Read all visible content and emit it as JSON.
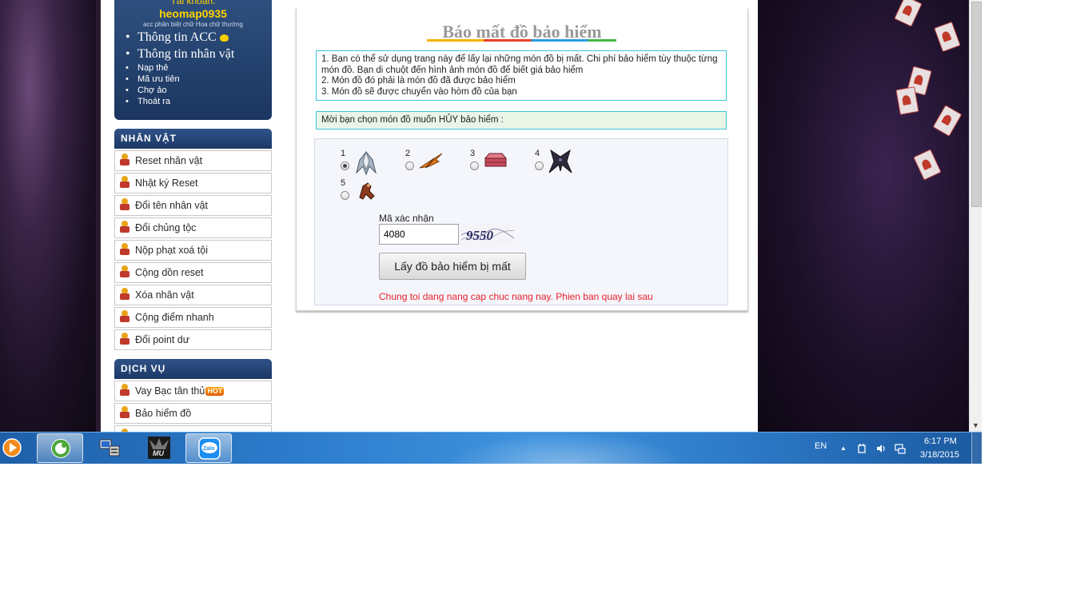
{
  "account": {
    "label": "Tài khoản:",
    "username": "heomap0935",
    "note": "acc phân biệt chữ Hoa chữ thường",
    "links_big": [
      "Thông tin ACC",
      "Thông tin nhân vật"
    ],
    "links_small": [
      "Nạp thẻ",
      "Mã ưu tiên",
      "Chợ ảo",
      "Thoát ra"
    ]
  },
  "character_section": {
    "title": "NHÂN VẬT",
    "items": [
      "Reset nhân vật",
      "Nhật ký Reset",
      "Đổi tên nhân vật",
      "Đổi chủng tộc",
      "Nộp phạt xoá tội",
      "Cộng dồn reset",
      "Xóa nhân vật",
      "Cộng điểm nhanh",
      "Đổi point dư"
    ]
  },
  "service_section": {
    "title": "DỊCH VỤ",
    "items": [
      "Vay Bạc tân thủ",
      "Bảo hiểm đồ"
    ],
    "hot_badge": "HOT"
  },
  "main": {
    "title": "Báo mất đồ bảo hiểm",
    "info_lines": [
      "1. Bạn có thể sử dụng trang này để lấy lại những món đồ bị mất. Chi phí bảo hiểm tùy thuộc từng món đồ. Bạn di chuột đến hình ảnh món đồ để biết giá bảo hiểm",
      "2. Món đồ đó phải là món đồ đã được bảo hiểm",
      "3. Món đồ sẽ được chuyển vào hòm đồ của bạn"
    ],
    "choose_prompt": "Mời bạn chọn món đồ muốn HỦY bảo hiểm :",
    "items": [
      {
        "number": "1",
        "selected": true,
        "icon": "wings-icon"
      },
      {
        "number": "2",
        "selected": false,
        "icon": "bow-icon"
      },
      {
        "number": "3",
        "selected": false,
        "icon": "chest-icon"
      },
      {
        "number": "4",
        "selected": false,
        "icon": "dark-wings-icon"
      },
      {
        "number": "5",
        "selected": false,
        "icon": "pet-icon"
      }
    ],
    "captcha_label": "Mã xác nhận",
    "captcha_value": "4080",
    "captcha_image_text": "9550",
    "submit_label": "Lấy đồ bảo hiểm bị mất",
    "notice": "Chung toi dang nang cap chuc nang nay. Phien ban quay lai sau"
  },
  "taskbar": {
    "language": "EN",
    "time": "6:17 PM",
    "date": "3/18/2015",
    "apps": [
      "media-player-icon",
      "coccoc-browser-icon",
      "network-computer-icon",
      "mu-game-icon",
      "zalo-icon"
    ],
    "zalo_label": "Zalo",
    "mu_label": "MU"
  },
  "colors": {
    "sidebar_head": "#1c3866",
    "account_name": "#ffd200",
    "notice": "#e8202a",
    "info_border": "#3cc5d6"
  }
}
